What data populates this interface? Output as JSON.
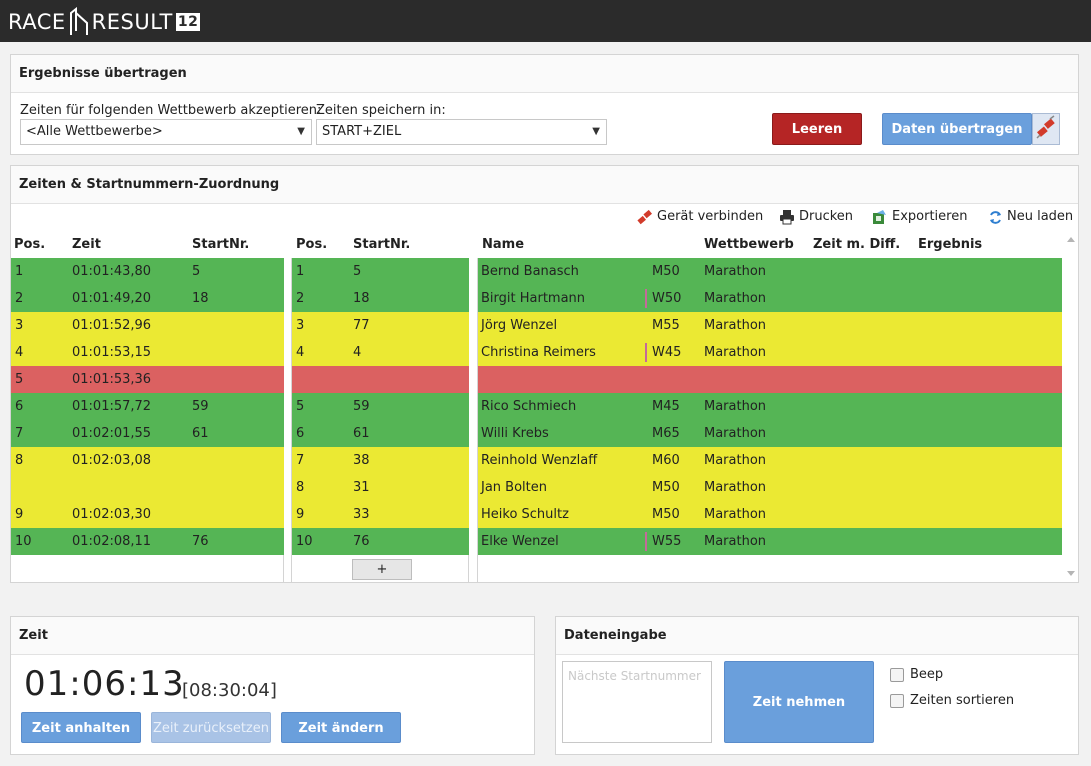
{
  "app": {
    "logo_left": "RACE",
    "logo_right": "RESULT",
    "logo_version": "12"
  },
  "transfer": {
    "title": "Ergebnisse übertragen",
    "accept_label": "Zeiten für folgenden Wettbewerb akzeptieren:",
    "accept_value": "<Alle Wettbewerbe>",
    "save_label": "Zeiten speichern in:",
    "save_value": "START+ZIEL",
    "clear_button": "Leeren",
    "send_button": "Daten übertragen"
  },
  "assign": {
    "title": "Zeiten & Startnummern-Zuordnung",
    "toolbar": {
      "connect": "Gerät verbinden",
      "print": "Drucken",
      "export": "Exportieren",
      "reload": "Neu laden"
    },
    "headers": {
      "pos": "Pos.",
      "time": "Zeit",
      "bib": "StartNr.",
      "pos2": "Pos.",
      "bib2": "StartNr.",
      "name": "Name",
      "contest": "Wettbewerb",
      "diff": "Zeit m. Diff.",
      "result": "Ergebnis"
    },
    "times": [
      {
        "pos": "1",
        "time": "01:01:43,80",
        "bib": "5",
        "status": "g"
      },
      {
        "pos": "2",
        "time": "01:01:49,20",
        "bib": "18",
        "status": "g"
      },
      {
        "pos": "3",
        "time": "01:01:52,96",
        "bib": "",
        "status": "y"
      },
      {
        "pos": "4",
        "time": "01:01:53,15",
        "bib": "",
        "status": "y"
      },
      {
        "pos": "5",
        "time": "01:01:53,36",
        "bib": "",
        "status": "r"
      },
      {
        "pos": "6",
        "time": "01:01:57,72",
        "bib": "59",
        "status": "g"
      },
      {
        "pos": "7",
        "time": "01:02:01,55",
        "bib": "61",
        "status": "g"
      },
      {
        "pos": "8",
        "time": "01:02:03,08",
        "bib": "",
        "status": "y"
      },
      {
        "pos": "",
        "time": "",
        "bib": "",
        "status": "y"
      },
      {
        "pos": "9",
        "time": "01:02:03,30",
        "bib": "",
        "status": "y"
      },
      {
        "pos": "10",
        "time": "01:02:08,11",
        "bib": "76",
        "status": "g"
      }
    ],
    "bibs": [
      {
        "pos": "1",
        "bib": "5",
        "status": "g"
      },
      {
        "pos": "2",
        "bib": "18",
        "status": "g"
      },
      {
        "pos": "3",
        "bib": "77",
        "status": "y"
      },
      {
        "pos": "4",
        "bib": "4",
        "status": "y"
      },
      {
        "pos": "",
        "bib": "",
        "status": "r"
      },
      {
        "pos": "5",
        "bib": "59",
        "status": "g"
      },
      {
        "pos": "6",
        "bib": "61",
        "status": "g"
      },
      {
        "pos": "7",
        "bib": "38",
        "status": "y"
      },
      {
        "pos": "8",
        "bib": "31",
        "status": "y"
      },
      {
        "pos": "9",
        "bib": "33",
        "status": "y"
      },
      {
        "pos": "10",
        "bib": "76",
        "status": "g"
      }
    ],
    "add_button": "+",
    "participants": [
      {
        "name": "Bernd Banasch",
        "cat": "M50",
        "contest": "Marathon",
        "female": false,
        "status": "g"
      },
      {
        "name": "Birgit Hartmann",
        "cat": "W50",
        "contest": "Marathon",
        "female": true,
        "status": "g"
      },
      {
        "name": "Jörg Wenzel",
        "cat": "M55",
        "contest": "Marathon",
        "female": false,
        "status": "y"
      },
      {
        "name": "Christina Reimers",
        "cat": "W45",
        "contest": "Marathon",
        "female": true,
        "status": "y"
      },
      {
        "name": "",
        "cat": "",
        "contest": "",
        "female": false,
        "status": "r"
      },
      {
        "name": "Rico Schmiech",
        "cat": "M45",
        "contest": "Marathon",
        "female": false,
        "status": "g"
      },
      {
        "name": "Willi Krebs",
        "cat": "M65",
        "contest": "Marathon",
        "female": false,
        "status": "g"
      },
      {
        "name": "Reinhold Wenzlaff",
        "cat": "M60",
        "contest": "Marathon",
        "female": false,
        "status": "y"
      },
      {
        "name": "Jan Bolten",
        "cat": "M50",
        "contest": "Marathon",
        "female": false,
        "status": "y"
      },
      {
        "name": "Heiko Schultz",
        "cat": "M50",
        "contest": "Marathon",
        "female": false,
        "status": "y"
      },
      {
        "name": "Elke Wenzel",
        "cat": "W55",
        "contest": "Marathon",
        "female": true,
        "status": "g"
      }
    ]
  },
  "clock": {
    "title": "Zeit",
    "time": "01:06:13",
    "daytime": "[08:30:04]",
    "stop_button": "Zeit anhalten",
    "reset_button": "Zeit zurücksetzen",
    "change_button": "Zeit ändern"
  },
  "entry": {
    "title": "Dateneingabe",
    "placeholder": "Nächste Startnummer",
    "take_button": "Zeit nehmen",
    "beep_label": "Beep",
    "sort_label": "Zeiten sortieren"
  },
  "colors": {
    "ok": "#55b555",
    "warn": "#ebe933",
    "error": "#db6161",
    "accent": "#6a9fdc",
    "danger": "#b52525"
  }
}
